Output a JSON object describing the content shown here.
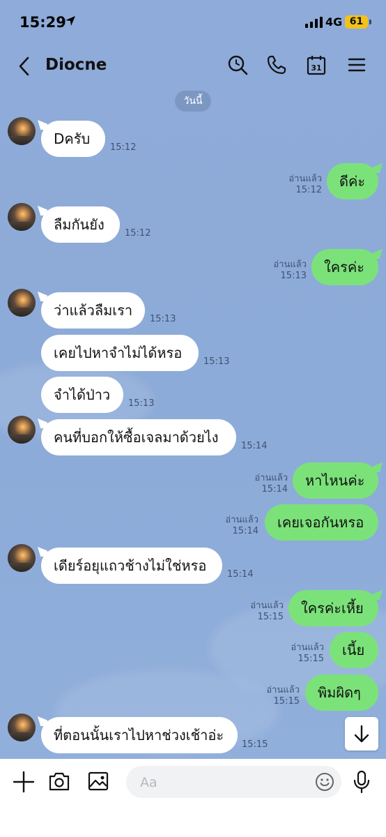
{
  "status_bar": {
    "time": "15:29",
    "network": "4G",
    "battery": "61",
    "battery_color": "#f2c21b"
  },
  "header": {
    "title": "Diocne",
    "icons": [
      "back-arrow-icon",
      "search-icon",
      "phone-icon",
      "calendar-icon",
      "menu-icon"
    ],
    "calendar_day": "31"
  },
  "date_divider": "วันนี้",
  "messages": [
    {
      "dir": "in",
      "text": "Dครับ",
      "time": "15:12"
    },
    {
      "dir": "out",
      "text": "ดีค่ะ",
      "read": "อ่านแล้ว",
      "time": "15:12"
    },
    {
      "dir": "in",
      "text": "ลืมกันยัง",
      "time": "15:12"
    },
    {
      "dir": "out",
      "text": "ใครค่ะ",
      "read": "อ่านแล้ว",
      "time": "15:13"
    },
    {
      "dir": "in",
      "text": "ว่าแล้วลืมเรา",
      "time": "15:13"
    },
    {
      "dir": "in",
      "text": "เคยไปหาจำไม่ได้หรอ",
      "time": "15:13"
    },
    {
      "dir": "in",
      "text": "จำได้ป่าว",
      "time": "15:13"
    },
    {
      "dir": "in",
      "text": "คนที่บอกให้ซื้อเจลมาด้วยไง",
      "time": "15:14"
    },
    {
      "dir": "out",
      "text": "หาไหนค่ะ",
      "read": "อ่านแล้ว",
      "time": "15:14"
    },
    {
      "dir": "out",
      "text": "เคยเจอกันหรอ",
      "read": "อ่านแล้ว",
      "time": "15:14"
    },
    {
      "dir": "in",
      "text": "เดียร์อยุแถวช้างไม่ใช่หรอ",
      "time": "15:14"
    },
    {
      "dir": "out",
      "text": "ใครค่ะเหี้ย",
      "read": "อ่านแล้ว",
      "time": "15:15"
    },
    {
      "dir": "out",
      "text": "เนี้ย",
      "read": "อ่านแล้ว",
      "time": "15:15"
    },
    {
      "dir": "out",
      "text": "พิมผิดๆ",
      "read": "อ่านแล้ว",
      "time": "15:15"
    },
    {
      "dir": "in",
      "text": "ที่ตอนนั้นเราไปหาช่วงเช้าอ่ะ",
      "time": "15:15"
    }
  ],
  "composer": {
    "placeholder": "Aa",
    "icons": [
      "plus-icon",
      "camera-icon",
      "image-icon",
      "emoji-icon",
      "microphone-icon"
    ]
  },
  "colors": {
    "chat_bg": "#8dabd8",
    "outgoing_bubble": "#7be27a",
    "incoming_bubble": "#ffffff"
  }
}
